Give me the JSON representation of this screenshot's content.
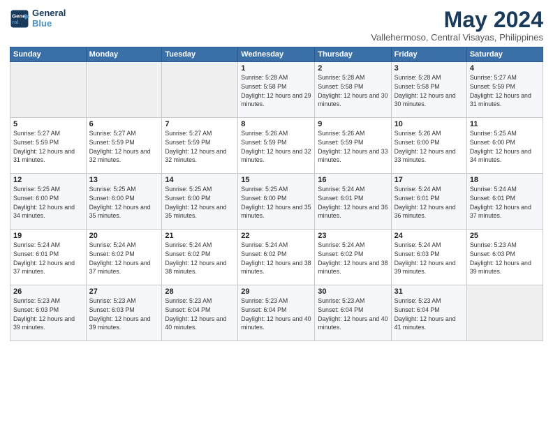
{
  "header": {
    "logo_line1": "General",
    "logo_line2": "Blue",
    "month": "May 2024",
    "location": "Vallehermoso, Central Visayas, Philippines"
  },
  "weekdays": [
    "Sunday",
    "Monday",
    "Tuesday",
    "Wednesday",
    "Thursday",
    "Friday",
    "Saturday"
  ],
  "weeks": [
    [
      {
        "day": "",
        "sunrise": "",
        "sunset": "",
        "daylight": ""
      },
      {
        "day": "",
        "sunrise": "",
        "sunset": "",
        "daylight": ""
      },
      {
        "day": "",
        "sunrise": "",
        "sunset": "",
        "daylight": ""
      },
      {
        "day": "1",
        "sunrise": "Sunrise: 5:28 AM",
        "sunset": "Sunset: 5:58 PM",
        "daylight": "Daylight: 12 hours and 29 minutes."
      },
      {
        "day": "2",
        "sunrise": "Sunrise: 5:28 AM",
        "sunset": "Sunset: 5:58 PM",
        "daylight": "Daylight: 12 hours and 30 minutes."
      },
      {
        "day": "3",
        "sunrise": "Sunrise: 5:28 AM",
        "sunset": "Sunset: 5:58 PM",
        "daylight": "Daylight: 12 hours and 30 minutes."
      },
      {
        "day": "4",
        "sunrise": "Sunrise: 5:27 AM",
        "sunset": "Sunset: 5:59 PM",
        "daylight": "Daylight: 12 hours and 31 minutes."
      }
    ],
    [
      {
        "day": "5",
        "sunrise": "Sunrise: 5:27 AM",
        "sunset": "Sunset: 5:59 PM",
        "daylight": "Daylight: 12 hours and 31 minutes."
      },
      {
        "day": "6",
        "sunrise": "Sunrise: 5:27 AM",
        "sunset": "Sunset: 5:59 PM",
        "daylight": "Daylight: 12 hours and 32 minutes."
      },
      {
        "day": "7",
        "sunrise": "Sunrise: 5:27 AM",
        "sunset": "Sunset: 5:59 PM",
        "daylight": "Daylight: 12 hours and 32 minutes."
      },
      {
        "day": "8",
        "sunrise": "Sunrise: 5:26 AM",
        "sunset": "Sunset: 5:59 PM",
        "daylight": "Daylight: 12 hours and 32 minutes."
      },
      {
        "day": "9",
        "sunrise": "Sunrise: 5:26 AM",
        "sunset": "Sunset: 5:59 PM",
        "daylight": "Daylight: 12 hours and 33 minutes."
      },
      {
        "day": "10",
        "sunrise": "Sunrise: 5:26 AM",
        "sunset": "Sunset: 6:00 PM",
        "daylight": "Daylight: 12 hours and 33 minutes."
      },
      {
        "day": "11",
        "sunrise": "Sunrise: 5:25 AM",
        "sunset": "Sunset: 6:00 PM",
        "daylight": "Daylight: 12 hours and 34 minutes."
      }
    ],
    [
      {
        "day": "12",
        "sunrise": "Sunrise: 5:25 AM",
        "sunset": "Sunset: 6:00 PM",
        "daylight": "Daylight: 12 hours and 34 minutes."
      },
      {
        "day": "13",
        "sunrise": "Sunrise: 5:25 AM",
        "sunset": "Sunset: 6:00 PM",
        "daylight": "Daylight: 12 hours and 35 minutes."
      },
      {
        "day": "14",
        "sunrise": "Sunrise: 5:25 AM",
        "sunset": "Sunset: 6:00 PM",
        "daylight": "Daylight: 12 hours and 35 minutes."
      },
      {
        "day": "15",
        "sunrise": "Sunrise: 5:25 AM",
        "sunset": "Sunset: 6:00 PM",
        "daylight": "Daylight: 12 hours and 35 minutes."
      },
      {
        "day": "16",
        "sunrise": "Sunrise: 5:24 AM",
        "sunset": "Sunset: 6:01 PM",
        "daylight": "Daylight: 12 hours and 36 minutes."
      },
      {
        "day": "17",
        "sunrise": "Sunrise: 5:24 AM",
        "sunset": "Sunset: 6:01 PM",
        "daylight": "Daylight: 12 hours and 36 minutes."
      },
      {
        "day": "18",
        "sunrise": "Sunrise: 5:24 AM",
        "sunset": "Sunset: 6:01 PM",
        "daylight": "Daylight: 12 hours and 37 minutes."
      }
    ],
    [
      {
        "day": "19",
        "sunrise": "Sunrise: 5:24 AM",
        "sunset": "Sunset: 6:01 PM",
        "daylight": "Daylight: 12 hours and 37 minutes."
      },
      {
        "day": "20",
        "sunrise": "Sunrise: 5:24 AM",
        "sunset": "Sunset: 6:02 PM",
        "daylight": "Daylight: 12 hours and 37 minutes."
      },
      {
        "day": "21",
        "sunrise": "Sunrise: 5:24 AM",
        "sunset": "Sunset: 6:02 PM",
        "daylight": "Daylight: 12 hours and 38 minutes."
      },
      {
        "day": "22",
        "sunrise": "Sunrise: 5:24 AM",
        "sunset": "Sunset: 6:02 PM",
        "daylight": "Daylight: 12 hours and 38 minutes."
      },
      {
        "day": "23",
        "sunrise": "Sunrise: 5:24 AM",
        "sunset": "Sunset: 6:02 PM",
        "daylight": "Daylight: 12 hours and 38 minutes."
      },
      {
        "day": "24",
        "sunrise": "Sunrise: 5:24 AM",
        "sunset": "Sunset: 6:03 PM",
        "daylight": "Daylight: 12 hours and 39 minutes."
      },
      {
        "day": "25",
        "sunrise": "Sunrise: 5:23 AM",
        "sunset": "Sunset: 6:03 PM",
        "daylight": "Daylight: 12 hours and 39 minutes."
      }
    ],
    [
      {
        "day": "26",
        "sunrise": "Sunrise: 5:23 AM",
        "sunset": "Sunset: 6:03 PM",
        "daylight": "Daylight: 12 hours and 39 minutes."
      },
      {
        "day": "27",
        "sunrise": "Sunrise: 5:23 AM",
        "sunset": "Sunset: 6:03 PM",
        "daylight": "Daylight: 12 hours and 39 minutes."
      },
      {
        "day": "28",
        "sunrise": "Sunrise: 5:23 AM",
        "sunset": "Sunset: 6:04 PM",
        "daylight": "Daylight: 12 hours and 40 minutes."
      },
      {
        "day": "29",
        "sunrise": "Sunrise: 5:23 AM",
        "sunset": "Sunset: 6:04 PM",
        "daylight": "Daylight: 12 hours and 40 minutes."
      },
      {
        "day": "30",
        "sunrise": "Sunrise: 5:23 AM",
        "sunset": "Sunset: 6:04 PM",
        "daylight": "Daylight: 12 hours and 40 minutes."
      },
      {
        "day": "31",
        "sunrise": "Sunrise: 5:23 AM",
        "sunset": "Sunset: 6:04 PM",
        "daylight": "Daylight: 12 hours and 41 minutes."
      },
      {
        "day": "",
        "sunrise": "",
        "sunset": "",
        "daylight": ""
      }
    ]
  ]
}
